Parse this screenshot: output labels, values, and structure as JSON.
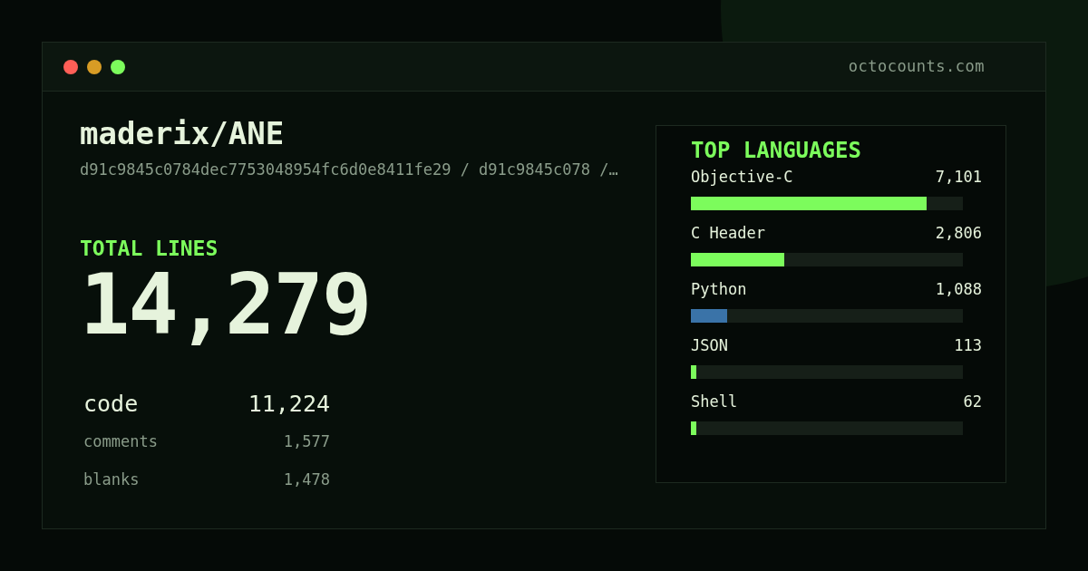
{
  "window": {
    "domain": "octocounts.com"
  },
  "repo": {
    "name": "maderix/ANE",
    "refs": "d91c9845c0784dec7753048954fc6d0e8411fe29 / d91c9845c078 /…"
  },
  "total": {
    "label": "TOTAL LINES",
    "value": "14,279"
  },
  "breakdown": [
    {
      "kind": "primary",
      "label": "code",
      "value": "11,224"
    },
    {
      "kind": "secondary",
      "label": "comments",
      "value": "1,577"
    },
    {
      "kind": "secondary",
      "label": "blanks",
      "value": "1,478"
    }
  ],
  "languages": {
    "title": "TOP LANGUAGES",
    "items": [
      {
        "name": "Objective-C",
        "count": "7,101",
        "level": 0.867,
        "color": "#7cfc5c"
      },
      {
        "name": "C Header",
        "count": "2,806",
        "level": 0.343,
        "color": "#7cfc5c"
      },
      {
        "name": "Python",
        "count": "1,088",
        "level": 0.133,
        "color": "#3a73a8"
      },
      {
        "name": "JSON",
        "count": "113",
        "level": 0.02,
        "color": "#7cfc5c"
      },
      {
        "name": "Shell",
        "count": "62",
        "level": 0.02,
        "color": "#7cfc5c"
      }
    ]
  }
}
